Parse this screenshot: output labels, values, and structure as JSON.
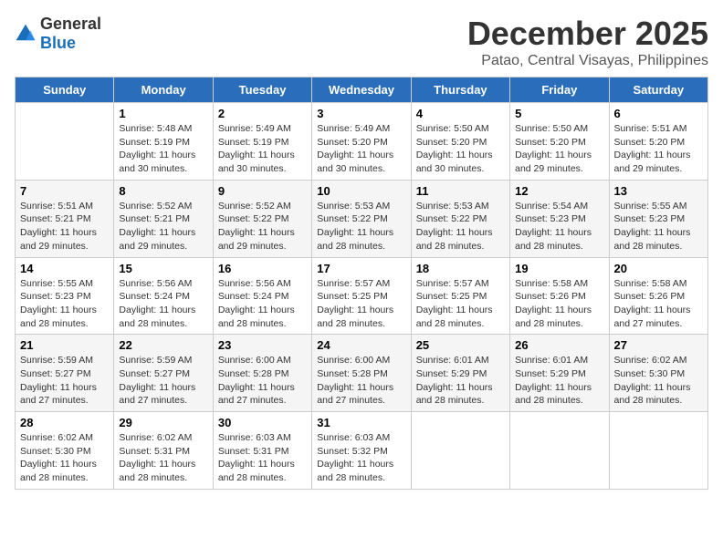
{
  "logo": {
    "general": "General",
    "blue": "Blue"
  },
  "title": "December 2025",
  "subtitle": "Patao, Central Visayas, Philippines",
  "days_of_week": [
    "Sunday",
    "Monday",
    "Tuesday",
    "Wednesday",
    "Thursday",
    "Friday",
    "Saturday"
  ],
  "weeks": [
    [
      {
        "num": "",
        "sunrise": "",
        "sunset": "",
        "daylight": ""
      },
      {
        "num": "1",
        "sunrise": "Sunrise: 5:48 AM",
        "sunset": "Sunset: 5:19 PM",
        "daylight": "Daylight: 11 hours and 30 minutes."
      },
      {
        "num": "2",
        "sunrise": "Sunrise: 5:49 AM",
        "sunset": "Sunset: 5:19 PM",
        "daylight": "Daylight: 11 hours and 30 minutes."
      },
      {
        "num": "3",
        "sunrise": "Sunrise: 5:49 AM",
        "sunset": "Sunset: 5:20 PM",
        "daylight": "Daylight: 11 hours and 30 minutes."
      },
      {
        "num": "4",
        "sunrise": "Sunrise: 5:50 AM",
        "sunset": "Sunset: 5:20 PM",
        "daylight": "Daylight: 11 hours and 30 minutes."
      },
      {
        "num": "5",
        "sunrise": "Sunrise: 5:50 AM",
        "sunset": "Sunset: 5:20 PM",
        "daylight": "Daylight: 11 hours and 29 minutes."
      },
      {
        "num": "6",
        "sunrise": "Sunrise: 5:51 AM",
        "sunset": "Sunset: 5:20 PM",
        "daylight": "Daylight: 11 hours and 29 minutes."
      }
    ],
    [
      {
        "num": "7",
        "sunrise": "Sunrise: 5:51 AM",
        "sunset": "Sunset: 5:21 PM",
        "daylight": "Daylight: 11 hours and 29 minutes."
      },
      {
        "num": "8",
        "sunrise": "Sunrise: 5:52 AM",
        "sunset": "Sunset: 5:21 PM",
        "daylight": "Daylight: 11 hours and 29 minutes."
      },
      {
        "num": "9",
        "sunrise": "Sunrise: 5:52 AM",
        "sunset": "Sunset: 5:22 PM",
        "daylight": "Daylight: 11 hours and 29 minutes."
      },
      {
        "num": "10",
        "sunrise": "Sunrise: 5:53 AM",
        "sunset": "Sunset: 5:22 PM",
        "daylight": "Daylight: 11 hours and 28 minutes."
      },
      {
        "num": "11",
        "sunrise": "Sunrise: 5:53 AM",
        "sunset": "Sunset: 5:22 PM",
        "daylight": "Daylight: 11 hours and 28 minutes."
      },
      {
        "num": "12",
        "sunrise": "Sunrise: 5:54 AM",
        "sunset": "Sunset: 5:23 PM",
        "daylight": "Daylight: 11 hours and 28 minutes."
      },
      {
        "num": "13",
        "sunrise": "Sunrise: 5:55 AM",
        "sunset": "Sunset: 5:23 PM",
        "daylight": "Daylight: 11 hours and 28 minutes."
      }
    ],
    [
      {
        "num": "14",
        "sunrise": "Sunrise: 5:55 AM",
        "sunset": "Sunset: 5:23 PM",
        "daylight": "Daylight: 11 hours and 28 minutes."
      },
      {
        "num": "15",
        "sunrise": "Sunrise: 5:56 AM",
        "sunset": "Sunset: 5:24 PM",
        "daylight": "Daylight: 11 hours and 28 minutes."
      },
      {
        "num": "16",
        "sunrise": "Sunrise: 5:56 AM",
        "sunset": "Sunset: 5:24 PM",
        "daylight": "Daylight: 11 hours and 28 minutes."
      },
      {
        "num": "17",
        "sunrise": "Sunrise: 5:57 AM",
        "sunset": "Sunset: 5:25 PM",
        "daylight": "Daylight: 11 hours and 28 minutes."
      },
      {
        "num": "18",
        "sunrise": "Sunrise: 5:57 AM",
        "sunset": "Sunset: 5:25 PM",
        "daylight": "Daylight: 11 hours and 28 minutes."
      },
      {
        "num": "19",
        "sunrise": "Sunrise: 5:58 AM",
        "sunset": "Sunset: 5:26 PM",
        "daylight": "Daylight: 11 hours and 28 minutes."
      },
      {
        "num": "20",
        "sunrise": "Sunrise: 5:58 AM",
        "sunset": "Sunset: 5:26 PM",
        "daylight": "Daylight: 11 hours and 27 minutes."
      }
    ],
    [
      {
        "num": "21",
        "sunrise": "Sunrise: 5:59 AM",
        "sunset": "Sunset: 5:27 PM",
        "daylight": "Daylight: 11 hours and 27 minutes."
      },
      {
        "num": "22",
        "sunrise": "Sunrise: 5:59 AM",
        "sunset": "Sunset: 5:27 PM",
        "daylight": "Daylight: 11 hours and 27 minutes."
      },
      {
        "num": "23",
        "sunrise": "Sunrise: 6:00 AM",
        "sunset": "Sunset: 5:28 PM",
        "daylight": "Daylight: 11 hours and 27 minutes."
      },
      {
        "num": "24",
        "sunrise": "Sunrise: 6:00 AM",
        "sunset": "Sunset: 5:28 PM",
        "daylight": "Daylight: 11 hours and 27 minutes."
      },
      {
        "num": "25",
        "sunrise": "Sunrise: 6:01 AM",
        "sunset": "Sunset: 5:29 PM",
        "daylight": "Daylight: 11 hours and 28 minutes."
      },
      {
        "num": "26",
        "sunrise": "Sunrise: 6:01 AM",
        "sunset": "Sunset: 5:29 PM",
        "daylight": "Daylight: 11 hours and 28 minutes."
      },
      {
        "num": "27",
        "sunrise": "Sunrise: 6:02 AM",
        "sunset": "Sunset: 5:30 PM",
        "daylight": "Daylight: 11 hours and 28 minutes."
      }
    ],
    [
      {
        "num": "28",
        "sunrise": "Sunrise: 6:02 AM",
        "sunset": "Sunset: 5:30 PM",
        "daylight": "Daylight: 11 hours and 28 minutes."
      },
      {
        "num": "29",
        "sunrise": "Sunrise: 6:02 AM",
        "sunset": "Sunset: 5:31 PM",
        "daylight": "Daylight: 11 hours and 28 minutes."
      },
      {
        "num": "30",
        "sunrise": "Sunrise: 6:03 AM",
        "sunset": "Sunset: 5:31 PM",
        "daylight": "Daylight: 11 hours and 28 minutes."
      },
      {
        "num": "31",
        "sunrise": "Sunrise: 6:03 AM",
        "sunset": "Sunset: 5:32 PM",
        "daylight": "Daylight: 11 hours and 28 minutes."
      },
      {
        "num": "",
        "sunrise": "",
        "sunset": "",
        "daylight": ""
      },
      {
        "num": "",
        "sunrise": "",
        "sunset": "",
        "daylight": ""
      },
      {
        "num": "",
        "sunrise": "",
        "sunset": "",
        "daylight": ""
      }
    ]
  ]
}
